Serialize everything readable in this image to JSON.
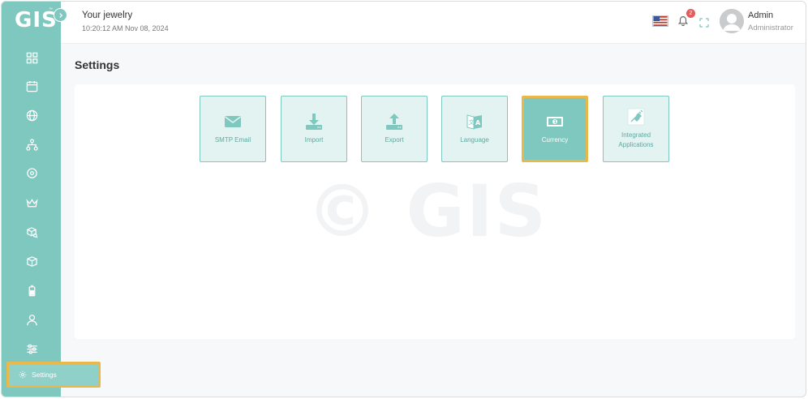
{
  "app": {
    "logo": "GIS",
    "logo_mark": "™"
  },
  "header": {
    "store_name": "Your jewelry",
    "datetime": "10:20:12 AM Nov 08, 2024",
    "notification_count": "2",
    "user_name": "Admin",
    "user_role": "Administrator"
  },
  "sidebar": {
    "icons": [
      "dashboard-icon",
      "calendar-icon",
      "globe-icon",
      "sitemap-icon",
      "location-pin-icon",
      "crown-icon",
      "box-search-icon",
      "package-icon",
      "battery-icon",
      "user-icon",
      "sliders-icon",
      "settings-gear-icon"
    ],
    "active_item_label": "Settings"
  },
  "page": {
    "title": "Settings",
    "watermark": "© GIS"
  },
  "tiles": [
    {
      "label": "SMTP Email",
      "icon": "envelope-icon",
      "active": false
    },
    {
      "label": "Import",
      "icon": "download-icon",
      "active": false
    },
    {
      "label": "Export",
      "icon": "upload-icon",
      "active": false
    },
    {
      "label": "Language",
      "icon": "translate-icon",
      "active": false
    },
    {
      "label": "Currency",
      "icon": "banknote-icon",
      "active": true
    },
    {
      "label": "Integrated Applications",
      "icon": "plug-icon",
      "active": false
    }
  ],
  "colors": {
    "sidebar": "#7ec8c0",
    "highlight": "#e9b84a",
    "tile_bg": "#e2f3f1",
    "badge": "#e35b5b"
  }
}
